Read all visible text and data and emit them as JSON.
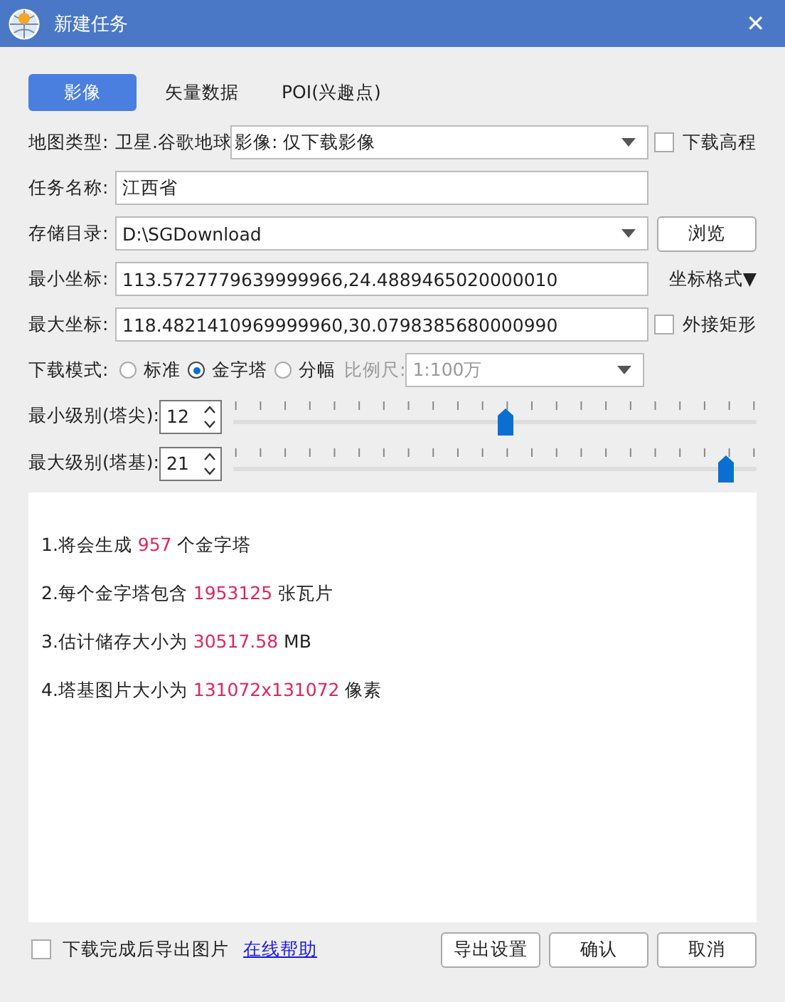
{
  "window": {
    "title": "新建任务",
    "close": "✕"
  },
  "tabs": [
    {
      "label": "影像",
      "selected": true
    },
    {
      "label": "矢量数据",
      "selected": false
    },
    {
      "label": "POI(兴趣点)",
      "selected": false
    }
  ],
  "map_type": {
    "label": "地图类型:",
    "source": "卫星.谷歌地球",
    "value": "影像: 仅下载影像",
    "elevation": {
      "label": "下载高程",
      "checked": false
    }
  },
  "task_name": {
    "label": "任务名称:",
    "value": "江西省"
  },
  "storage": {
    "label": "存储目录:",
    "value": "D:\\SGDownload",
    "button": "浏览"
  },
  "min_coord": {
    "label": "最小坐标:",
    "value": "113.5727779639999966,24.4889465020000010",
    "format_menu": "坐标格式▼"
  },
  "max_coord": {
    "label": "最大坐标:",
    "value": "118.4821410969999960,30.0798385680000990",
    "bounding": {
      "label": "外接矩形",
      "checked": false
    }
  },
  "download_mode": {
    "label": "下载模式:",
    "options": [
      {
        "label": "标准",
        "selected": false
      },
      {
        "label": "金字塔",
        "selected": true
      },
      {
        "label": "分幅",
        "selected": false
      }
    ],
    "scale": {
      "label": "比例尺:",
      "value": "1:100万",
      "disabled": true
    }
  },
  "levels": [
    {
      "label": "最小级别(塔尖):",
      "value": "12",
      "level": 0.52
    },
    {
      "label": "最大级别(塔基):",
      "value": "21",
      "level": 0.94
    }
  ],
  "info": [
    {
      "before": "1.将会生成",
      "value": "957",
      "after": "个金字塔"
    },
    {
      "before": "2.每个金字塔包含",
      "value": "1953125",
      "after": "张瓦片"
    },
    {
      "before": "3.估计储存大小为",
      "value": "30517.58",
      "after": "MB"
    },
    {
      "before": "4.塔基图片大小为",
      "value": "131072x131072",
      "after": "像素"
    }
  ],
  "export_after": {
    "label": "下载完成后导出图片",
    "checked": false
  },
  "help_link": "在线帮助",
  "buttons": [
    "导出设置",
    "确认",
    "取消"
  ]
}
